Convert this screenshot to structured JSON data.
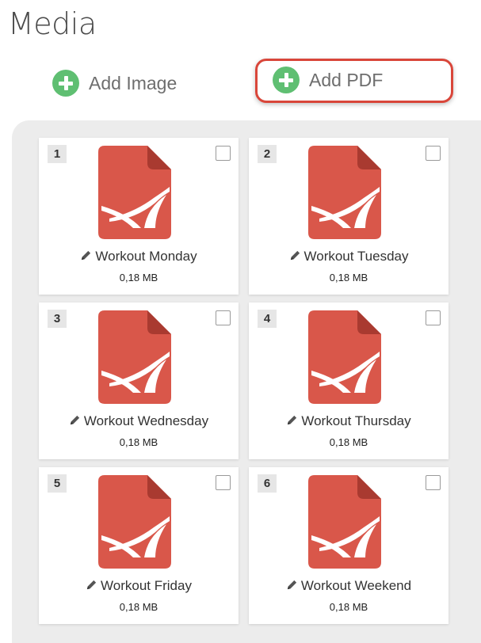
{
  "page": {
    "title": "Media"
  },
  "toolbar": {
    "add_image_label": "Add Image",
    "add_pdf_label": "Add PDF"
  },
  "icons": {
    "add": "plus-circle-icon",
    "file": "pdf-file-icon",
    "edit": "pencil-icon"
  },
  "colors": {
    "accent_green": "#5fbf72",
    "pdf_red": "#d9574a",
    "highlight_red": "#d9463a"
  },
  "media": {
    "items": [
      {
        "number": "1",
        "name": "Workout Monday",
        "size": "0,18 MB"
      },
      {
        "number": "2",
        "name": "Workout Tuesday",
        "size": "0,18 MB"
      },
      {
        "number": "3",
        "name": "Workout Wednesday",
        "size": "0,18 MB"
      },
      {
        "number": "4",
        "name": "Workout Thursday",
        "size": "0,18 MB"
      },
      {
        "number": "5",
        "name": "Workout Friday",
        "size": "0,18 MB"
      },
      {
        "number": "6",
        "name": "Workout Weekend",
        "size": "0,18 MB"
      }
    ]
  }
}
